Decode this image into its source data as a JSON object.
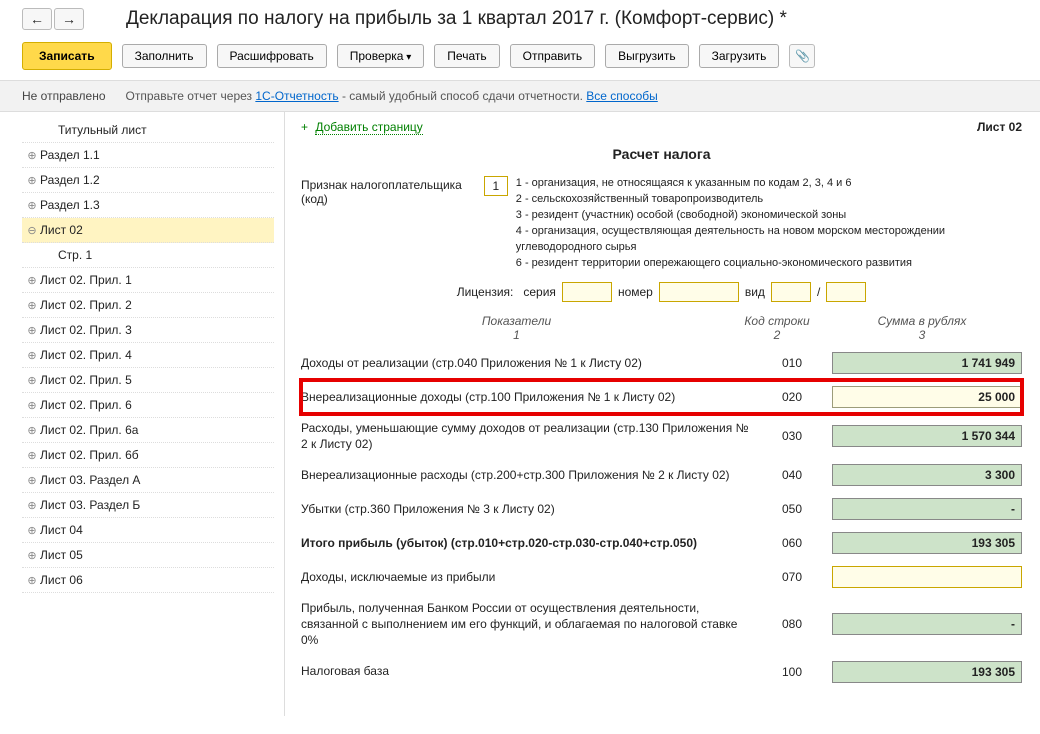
{
  "header": {
    "title": "Декларация по налогу на прибыль за 1 квартал 2017 г. (Комфорт-сервис) *"
  },
  "toolbar": {
    "save": "Записать",
    "fill": "Заполнить",
    "decode": "Расшифровать",
    "check": "Проверка",
    "print": "Печать",
    "send": "Отправить",
    "export": "Выгрузить",
    "import": "Загрузить"
  },
  "status": {
    "state": "Не отправлено",
    "hint_prefix": "Отправьте отчет через ",
    "hint_link": "1С-Отчетность",
    "hint_suffix": " - самый удобный способ сдачи отчетности. ",
    "all_ways": "Все способы"
  },
  "sidebar": {
    "items": [
      {
        "label": "Титульный лист",
        "exp": "",
        "indent": 1
      },
      {
        "label": "Раздел 1.1",
        "exp": "⊕"
      },
      {
        "label": "Раздел 1.2",
        "exp": "⊕"
      },
      {
        "label": "Раздел 1.3",
        "exp": "⊕"
      },
      {
        "label": "Лист 02",
        "exp": "⊖",
        "active": true
      },
      {
        "label": "Стр. 1",
        "exp": "",
        "indent": 1
      },
      {
        "label": "Лист 02. Прил. 1",
        "exp": "⊕"
      },
      {
        "label": "Лист 02. Прил. 2",
        "exp": "⊕"
      },
      {
        "label": "Лист 02. Прил. 3",
        "exp": "⊕"
      },
      {
        "label": "Лист 02. Прил. 4",
        "exp": "⊕"
      },
      {
        "label": "Лист 02. Прил. 5",
        "exp": "⊕"
      },
      {
        "label": "Лист 02. Прил. 6",
        "exp": "⊕"
      },
      {
        "label": "Лист 02. Прил. 6а",
        "exp": "⊕"
      },
      {
        "label": "Лист 02. Прил. 6б",
        "exp": "⊕"
      },
      {
        "label": "Лист 03. Раздел А",
        "exp": "⊕"
      },
      {
        "label": "Лист 03. Раздел Б",
        "exp": "⊕"
      },
      {
        "label": "Лист 04",
        "exp": "⊕"
      },
      {
        "label": "Лист 05",
        "exp": "⊕"
      },
      {
        "label": "Лист 06",
        "exp": "⊕"
      }
    ]
  },
  "content": {
    "add_page": "Добавить страницу",
    "sheet_label": "Лист 02",
    "section_title": "Расчет налога",
    "taxpayer_label": "Признак налогоплательщика (код)",
    "taxpayer_code": "1",
    "codes": [
      "1 - организация, не относящаяся к указанным по кодам 2, 3, 4 и 6",
      "2 - сельскохозяйственный товаропроизводитель",
      "3 - резидент (участник) особой (свободной) экономической зоны",
      "4 - организация, осуществляющая деятельность на новом морском месторождении углеводородного сырья",
      "6 - резидент территории опережающего социально-экономического развития"
    ],
    "license": {
      "label": "Лицензия:",
      "series": "серия",
      "number": "номер",
      "kind": "вид",
      "slash": "/"
    },
    "cols": {
      "c1": "Показатели",
      "c1n": "1",
      "c2": "Код строки",
      "c2n": "2",
      "c3": "Сумма в рублях",
      "c3n": "3"
    },
    "rows": [
      {
        "desc": "Доходы от реализации (стр.040 Приложения № 1 к Листу 02)",
        "code": "010",
        "sum": "1 741 949",
        "style": "green"
      },
      {
        "desc": "Внереализационные доходы (стр.100 Приложения № 1 к Листу 02)",
        "code": "020",
        "sum": "25 000",
        "style": "hl"
      },
      {
        "desc": "Расходы, уменьшающие сумму доходов от реализации (стр.130 Приложения № 2 к Листу 02)",
        "code": "030",
        "sum": "1 570 344",
        "style": "green"
      },
      {
        "desc": "Внереализационные расходы (стр.200+стр.300 Приложения № 2 к Листу 02)",
        "code": "040",
        "sum": "3 300",
        "style": "green"
      },
      {
        "desc": "Убытки (стр.360 Приложения № 3 к Листу 02)",
        "code": "050",
        "sum": "-",
        "style": "green"
      },
      {
        "desc": "Итого прибыль (убыток)  (стр.010+стр.020-стр.030-стр.040+стр.050)",
        "code": "060",
        "sum": "193 305",
        "style": "green",
        "bold": true
      },
      {
        "desc": "Доходы, исключаемые из прибыли",
        "code": "070",
        "sum": "",
        "style": "empty"
      },
      {
        "desc": "Прибыль, полученная Банком России от осуществления деятельности, связанной с выполнением им его функций, и облагаемая по налоговой ставке 0%",
        "code": "080",
        "sum": "-",
        "style": "green"
      },
      {
        "desc": "Налоговая база",
        "code": "100",
        "sum": "193 305",
        "style": "green"
      }
    ]
  }
}
